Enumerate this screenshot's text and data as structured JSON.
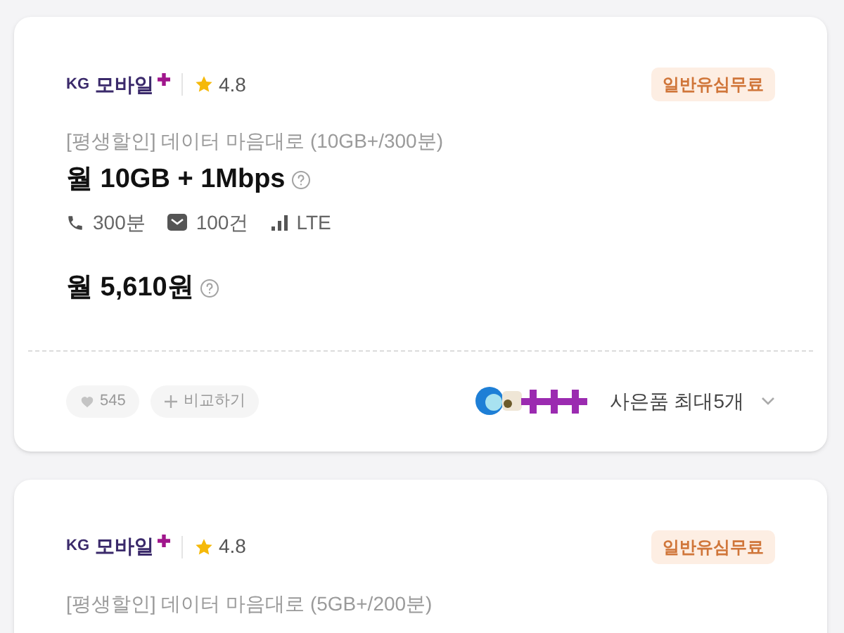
{
  "plans": [
    {
      "brand": "KG 모바일",
      "rating": "4.8",
      "badge": "일반유심무료",
      "plan_name": "[평생할인] 데이터 마음대로 (10GB+/300분)",
      "data": "월 10GB + 1Mbps",
      "specs": [
        {
          "kind": "call",
          "text": "300분"
        },
        {
          "kind": "sms",
          "text": "100건"
        },
        {
          "kind": "network",
          "text": "LTE"
        }
      ],
      "price": "월 5,610원",
      "likes": "545",
      "compare": "비교하기",
      "gifts": "사은품 최대5개"
    },
    {
      "brand": "KG 모바일",
      "rating": "4.8",
      "badge": "일반유심무료",
      "plan_name": "[평생할인] 데이터 마음대로 (5GB+/200분)"
    }
  ]
}
